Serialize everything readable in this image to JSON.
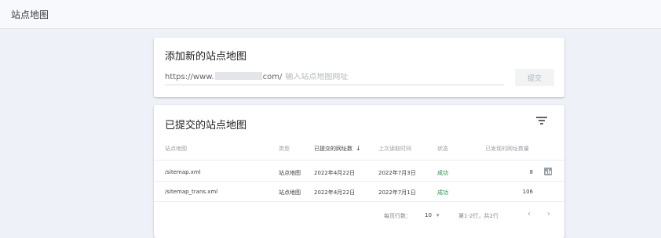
{
  "page": {
    "title": "站点地图"
  },
  "add_card": {
    "title": "添加新的站点地图",
    "url_prefix": "https://www.",
    "url_suffix": "com/",
    "input_placeholder": "输入站点地图网址",
    "submit_label": "提交"
  },
  "submitted_card": {
    "title": "已提交的站点地图",
    "headers": {
      "sitemap": "站点地图",
      "type": "类型",
      "submitted": "已提交的网址数",
      "last_read": "上次读取时间",
      "status": "状态",
      "discovered": "已发现的网址数量"
    },
    "rows": [
      {
        "sitemap": "/sitemap.xml",
        "type": "站点地图",
        "submitted": "2022年4月22日",
        "last_read": "2022年7月3日",
        "status": "成功",
        "discovered": "8"
      },
      {
        "sitemap": "/sitemap_trans.xml",
        "type": "站点地图",
        "submitted": "2022年4月22日",
        "last_read": "2022年7月1日",
        "status": "成功",
        "discovered": "106"
      }
    ],
    "footer": {
      "rows_per_page_label": "每页行数：",
      "rows_per_page_value": "10",
      "range_text": "第1-2行，共2行"
    }
  },
  "colors": {
    "success": "#1e8e3e",
    "background": "#eef1f7"
  },
  "icons": {
    "filter": "filter-icon",
    "sort": "arrow-down-icon",
    "chart": "bar-chart-icon",
    "dropdown": "dropdown-caret-icon",
    "prev": "chevron-left-icon",
    "next": "chevron-right-icon"
  }
}
